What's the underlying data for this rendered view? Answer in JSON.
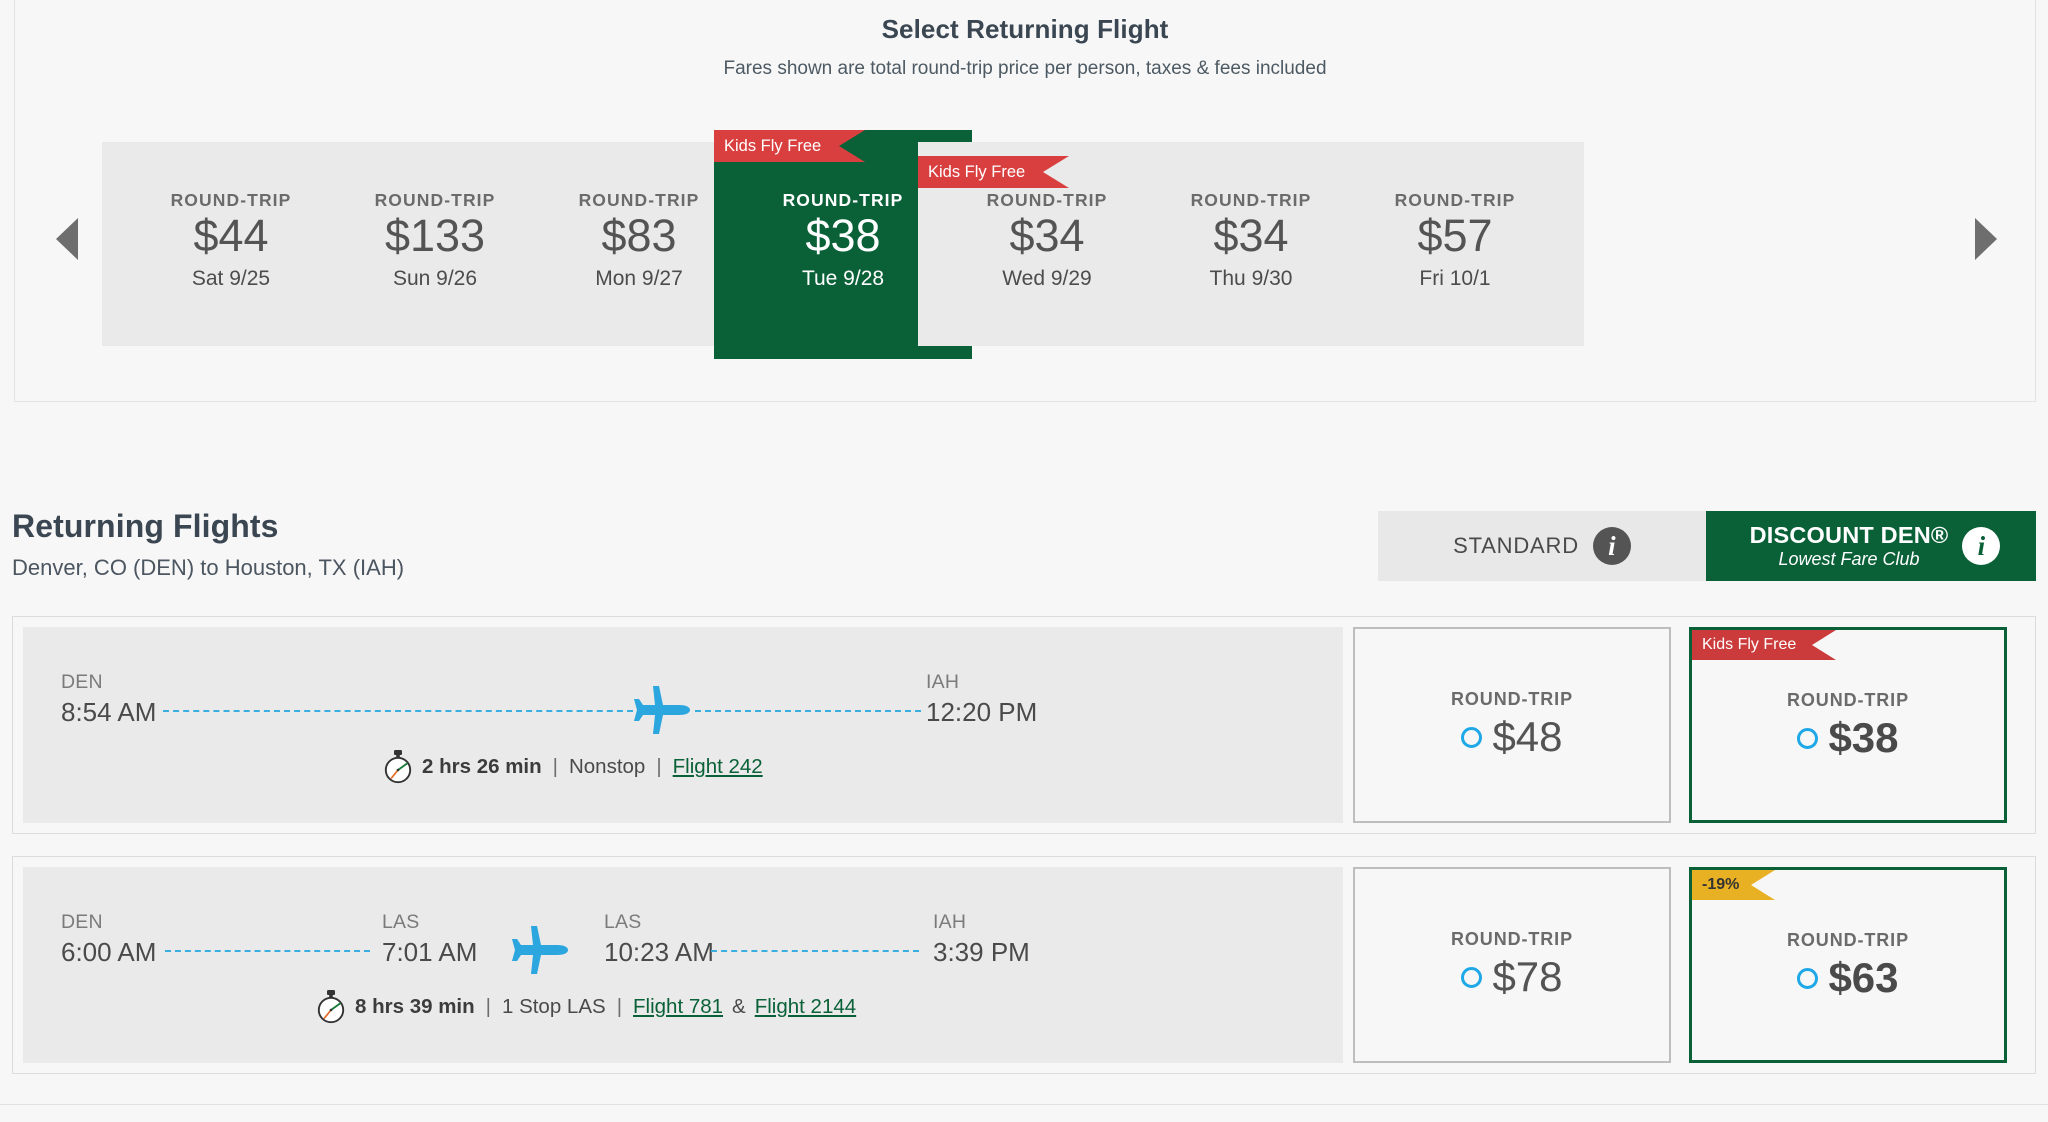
{
  "carousel": {
    "title": "Select Returning Flight",
    "subtitle": "Fares shown are total round-trip price per person, taxes & fees included",
    "prev_arrow": "previous-dates",
    "next_arrow": "next-dates",
    "round_trip_label": "ROUND-TRIP",
    "kids_fly_free_label": "Kids Fly Free",
    "dates": [
      {
        "label": "ROUND-TRIP",
        "price": "$44",
        "date": "Sat 9/25",
        "selected": false,
        "badge": null
      },
      {
        "label": "ROUND-TRIP",
        "price": "$133",
        "date": "Sun 9/26",
        "selected": false,
        "badge": null
      },
      {
        "label": "ROUND-TRIP",
        "price": "$83",
        "date": "Mon 9/27",
        "selected": false,
        "badge": null
      },
      {
        "label": "ROUND-TRIP",
        "price": "$38",
        "date": "Tue 9/28",
        "selected": true,
        "badge": "Kids Fly Free"
      },
      {
        "label": "ROUND-TRIP",
        "price": "$34",
        "date": "Wed 9/29",
        "selected": false,
        "badge": "Kids Fly Free"
      },
      {
        "label": "ROUND-TRIP",
        "price": "$34",
        "date": "Thu 9/30",
        "selected": false,
        "badge": null
      },
      {
        "label": "ROUND-TRIP",
        "price": "$57",
        "date": "Fri 10/1",
        "selected": false,
        "badge": null
      }
    ]
  },
  "section": {
    "title": "Returning Flights",
    "route": "Denver, CO (DEN) to Houston, TX (IAH)"
  },
  "fare_tabs": {
    "standard": {
      "label": "STANDARD",
      "info": "i"
    },
    "discount": {
      "label": "DISCOUNT DEN®",
      "sublabel": "Lowest Fare Club",
      "info": "i"
    }
  },
  "flights": [
    {
      "depart_code": "DEN",
      "depart_time": "8:54 AM",
      "arrive_code": "IAH",
      "arrive_time": "12:20 PM",
      "duration": "2 hrs 26 min",
      "stops": "Nonstop",
      "flight_numbers": [
        "Flight 242"
      ],
      "flight_sep": "",
      "standard": {
        "label": "ROUND-TRIP",
        "price": "$48",
        "badge": null
      },
      "discount": {
        "label": "ROUND-TRIP",
        "price": "$38",
        "badge": "Kids Fly Free",
        "badge_type": "red"
      }
    },
    {
      "depart_code": "DEN",
      "depart_time": "6:00 AM",
      "stop_in_code": "LAS",
      "stop_in_time": "7:01 AM",
      "stop_out_code": "LAS",
      "stop_out_time": "10:23 AM",
      "arrive_code": "IAH",
      "arrive_time": "3:39 PM",
      "duration": "8 hrs 39 min",
      "stops": "1 Stop LAS",
      "flight_numbers": [
        "Flight 781",
        "Flight 2144"
      ],
      "flight_sep": "&",
      "standard": {
        "label": "ROUND-TRIP",
        "price": "$78",
        "badge": null
      },
      "discount": {
        "label": "ROUND-TRIP",
        "price": "$63",
        "badge": "-19%",
        "badge_type": "gold"
      }
    }
  ],
  "colors": {
    "brand_green": "#0a6138",
    "ribbon_red": "#cc3b3b",
    "ribbon_gold": "#e8b023",
    "accent_blue": "#1fa8e8",
    "plane_blue": "#2ba6de"
  }
}
